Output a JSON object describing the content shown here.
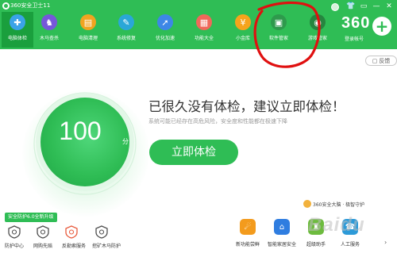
{
  "app": {
    "title": "360安全卫士11",
    "window_controls": [
      "▭",
      "—",
      "✕"
    ]
  },
  "nav": {
    "items": [
      {
        "label": "电脑体检",
        "icon": "monitor-check-icon",
        "color": "#3aa3e8",
        "glyph": "✚",
        "active": true
      },
      {
        "label": "木马查杀",
        "icon": "trojan-scan-icon",
        "color": "#7657d9",
        "glyph": "♞"
      },
      {
        "label": "电脑清理",
        "icon": "cleanup-icon",
        "color": "#f1a420",
        "glyph": "▤"
      },
      {
        "label": "系统修复",
        "icon": "repair-icon",
        "color": "#2aa7d8",
        "glyph": "✎"
      },
      {
        "label": "优化加速",
        "icon": "rocket-icon",
        "color": "#3d87e6",
        "glyph": "➚"
      },
      {
        "label": "功能大全",
        "icon": "grid-icon",
        "color": "#f0685a",
        "glyph": "▦"
      },
      {
        "label": "小金库",
        "icon": "coin-icon",
        "color": "#f6a41c",
        "glyph": "¥"
      },
      {
        "label": "软件管家",
        "icon": "software-manager-icon",
        "color": "#2e9a4c",
        "glyph": "▣"
      },
      {
        "label": "游戏管家",
        "icon": "gamepad-icon",
        "color": "#26853f",
        "glyph": "◉"
      }
    ]
  },
  "brand": {
    "logo_text": "360",
    "login_label": "登录帐号",
    "plus": "+"
  },
  "feedback": {
    "label": "反馈"
  },
  "score": {
    "value": "100",
    "unit": "分"
  },
  "main": {
    "headline": "已很久没有体检，建议立即体检！",
    "subtext": "系统可能已经存在高危风险，安全度和性能都在极速下降",
    "check_button": "立即体检"
  },
  "protection": {
    "badge": "安全防护6.0全新升级",
    "items": [
      {
        "label": "防护中心",
        "icon": "shield-icon",
        "color": "#4d4d4d"
      },
      {
        "label": "网购先赔",
        "icon": "shopping-cart-icon",
        "color": "#4d4d4d"
      },
      {
        "label": "反勒索服务",
        "icon": "anti-ransom-icon",
        "color": "#e85a3c"
      },
      {
        "label": "挖矿木马防护",
        "icon": "mining-protect-icon",
        "color": "#4d4d4d"
      }
    ]
  },
  "brain": {
    "text": "360安全大脑 · 极智守护"
  },
  "tools": [
    {
      "label": "新功能尝鲜",
      "icon": "new-feature-icon",
      "color": "#f39b1d",
      "glyph": "☄"
    },
    {
      "label": "智能家居安全",
      "icon": "smart-home-icon",
      "color": "#2f7de0",
      "glyph": "⌂"
    },
    {
      "label": "超级助手",
      "icon": "assistant-icon",
      "color": "#6dbb3e",
      "glyph": "♜"
    },
    {
      "label": "人工服务",
      "icon": "customer-service-icon",
      "color": "#2d9ad8",
      "glyph": "☎"
    }
  ],
  "more": "›",
  "watermark": "Baidu"
}
